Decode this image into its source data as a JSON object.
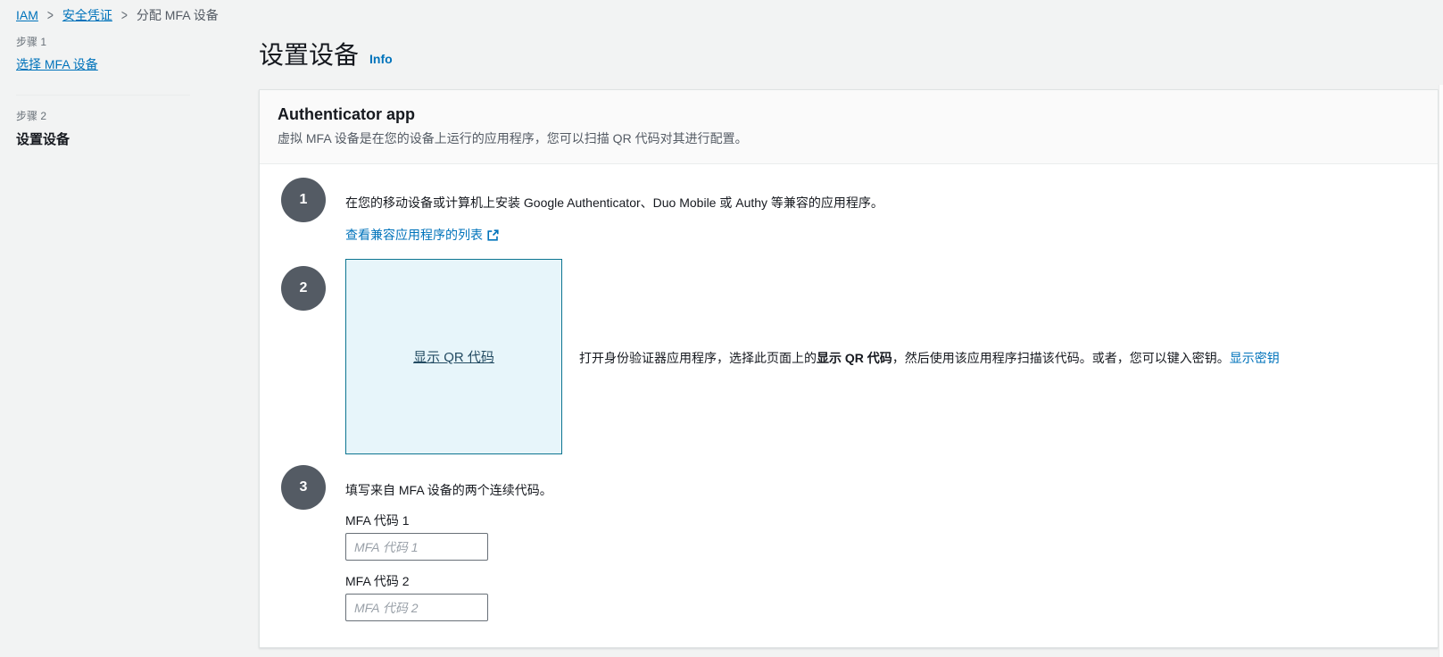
{
  "breadcrumb": {
    "separator": ">",
    "items": [
      {
        "label": "IAM"
      },
      {
        "label": "安全凭证"
      },
      {
        "label": "分配 MFA 设备"
      }
    ]
  },
  "sidebar": {
    "steps": [
      {
        "step_label": "步骤 1",
        "title": "选择 MFA 设备"
      },
      {
        "step_label": "步骤 2",
        "title": "设置设备"
      }
    ]
  },
  "header": {
    "title": "设置设备",
    "info_label": "Info"
  },
  "card": {
    "title": "Authenticator app",
    "subtitle": "虚拟 MFA 设备是在您的设备上运行的应用程序，您可以扫描 QR 代码对其进行配置。",
    "step1": {
      "number": "1",
      "text": "在您的移动设备或计算机上安装 Google Authenticator、Duo Mobile 或 Authy 等兼容的应用程序。",
      "link_label": "查看兼容应用程序的列表"
    },
    "step2": {
      "number": "2",
      "qr_link_label": "显示 QR 代码",
      "text_before": "打开身份验证器应用程序，选择此页面上的",
      "text_bold": "显示 QR 代码",
      "text_after": "，然后使用该应用程序扫描该代码。或者，您可以键入密钥。",
      "secret_link_label": "显示密钥"
    },
    "step3": {
      "number": "3",
      "text": "填写来自 MFA 设备的两个连续代码。",
      "fields": [
        {
          "label": "MFA 代码 1",
          "placeholder": "MFA 代码 1",
          "value": ""
        },
        {
          "label": "MFA 代码 2",
          "placeholder": "MFA 代码 2",
          "value": ""
        }
      ]
    }
  },
  "colors": {
    "page_background": "#f2f3f3",
    "link_blue": "#0073bb",
    "step_circle": "#545b64",
    "qr_box_background": "#e7f5fa",
    "qr_box_border": "#0d7591",
    "text_dark": "#16191f",
    "text_muted": "#687078"
  }
}
